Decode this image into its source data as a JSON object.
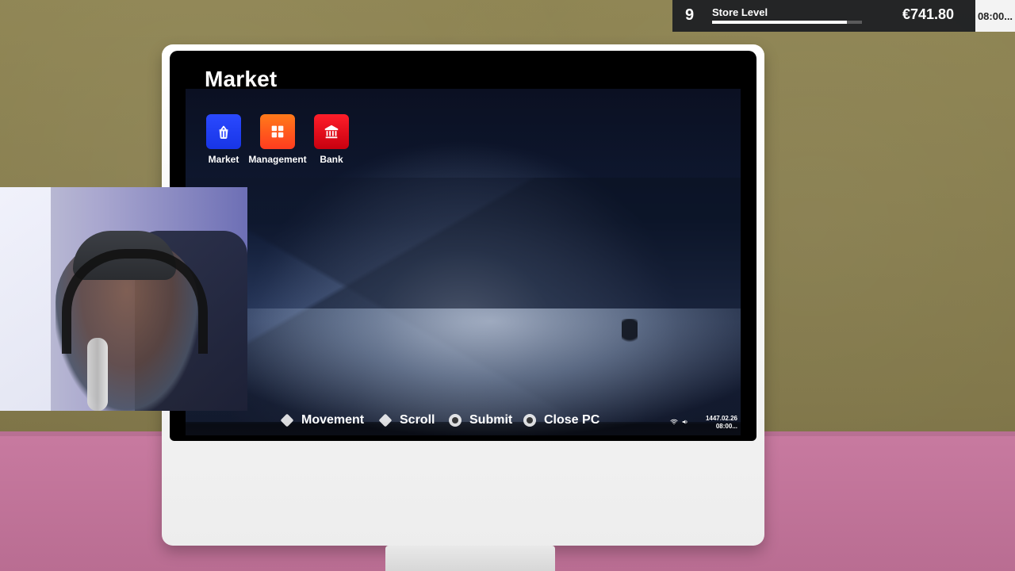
{
  "hud": {
    "store_level_number": "9",
    "store_level_label": "Store Level",
    "store_level_progress": 0.9,
    "money": "€741.80",
    "time": "08:00..."
  },
  "pc": {
    "title": "Market",
    "apps": [
      {
        "label": "Market",
        "icon": "shopping-basket-icon"
      },
      {
        "label": "Management",
        "icon": "dashboard-grid-icon"
      },
      {
        "label": "Bank",
        "icon": "bank-icon"
      }
    ],
    "hints": [
      {
        "label": "Movement",
        "icon": "dpad-icon"
      },
      {
        "label": "Scroll",
        "icon": "dpad-icon"
      },
      {
        "label": "Submit",
        "icon": "x-button-icon"
      },
      {
        "label": "Close PC",
        "icon": "o-button-icon"
      }
    ],
    "tray": {
      "date": "1447.02.26",
      "time": "08:00..."
    }
  },
  "colors": {
    "market_tile": "#1f3cff",
    "management_tile": "#ff5a1f",
    "bank_tile": "#e0121f"
  }
}
